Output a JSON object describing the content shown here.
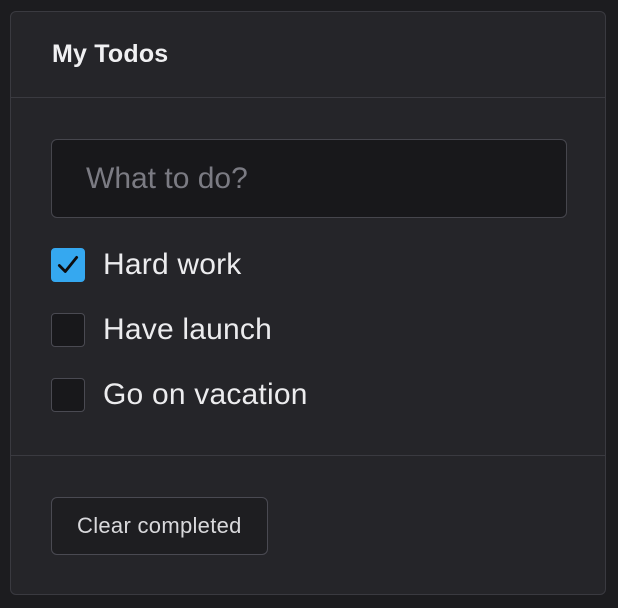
{
  "header": {
    "title": "My Todos"
  },
  "input": {
    "placeholder": "What to do?",
    "value": ""
  },
  "todos": [
    {
      "label": "Hard work",
      "completed": true
    },
    {
      "label": "Have launch",
      "completed": false
    },
    {
      "label": "Go on vacation",
      "completed": false
    }
  ],
  "footer": {
    "clear_label": "Clear completed"
  },
  "colors": {
    "accent": "#35a8f0",
    "background": "#252529"
  },
  "icons": {
    "checked": "checkmark-icon"
  }
}
